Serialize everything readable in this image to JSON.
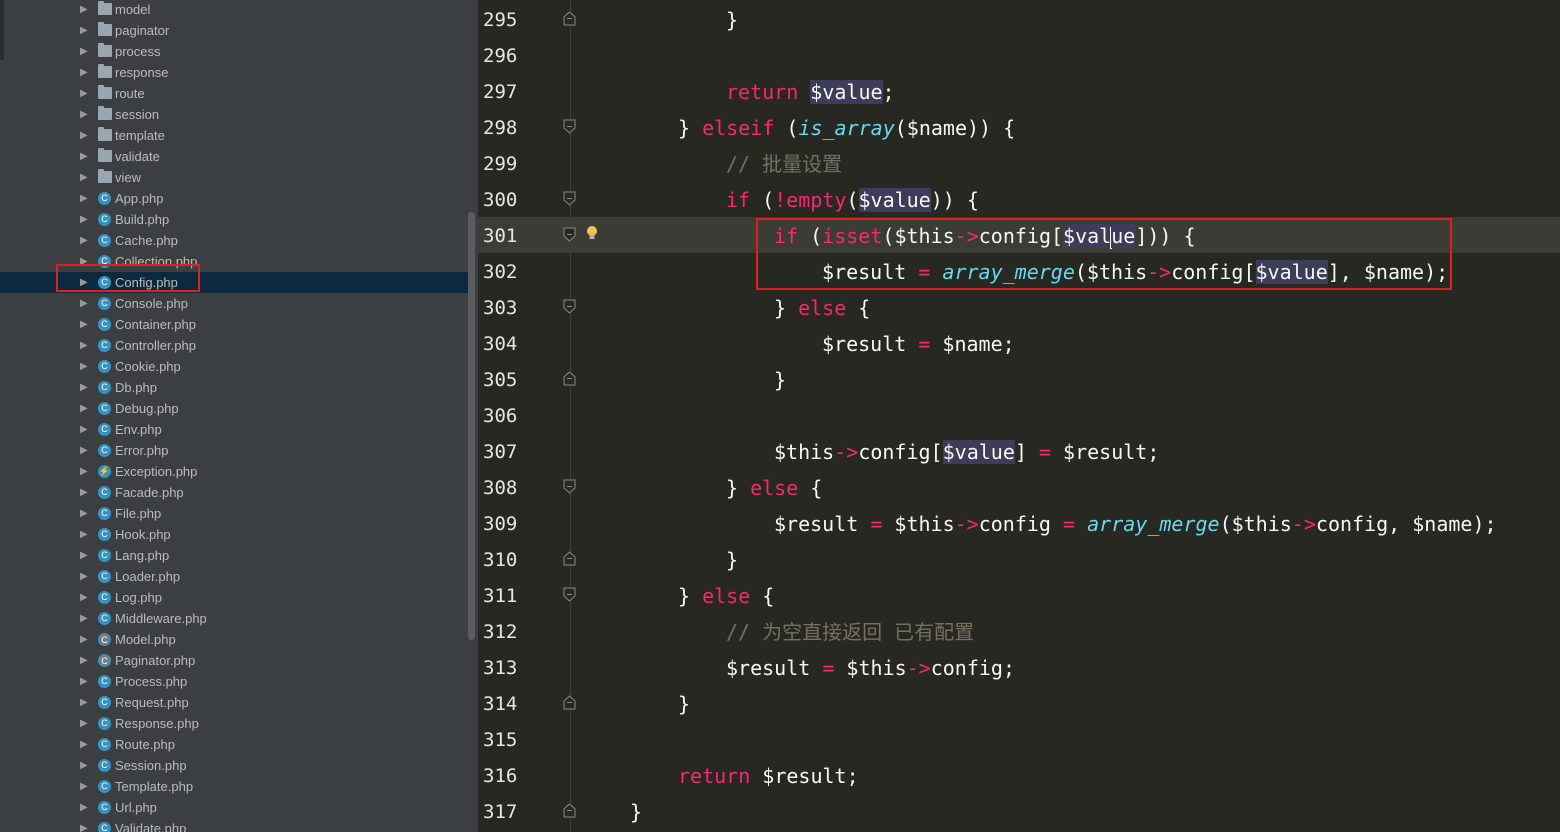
{
  "project_tree": {
    "items": [
      {
        "name": "model",
        "type": "folder"
      },
      {
        "name": "paginator",
        "type": "folder"
      },
      {
        "name": "process",
        "type": "folder"
      },
      {
        "name": "response",
        "type": "folder"
      },
      {
        "name": "route",
        "type": "folder"
      },
      {
        "name": "session",
        "type": "folder"
      },
      {
        "name": "template",
        "type": "folder"
      },
      {
        "name": "validate",
        "type": "folder"
      },
      {
        "name": "view",
        "type": "folder"
      },
      {
        "name": "App.php",
        "type": "class"
      },
      {
        "name": "Build.php",
        "type": "class"
      },
      {
        "name": "Cache.php",
        "type": "class"
      },
      {
        "name": "Collection.php",
        "type": "class"
      },
      {
        "name": "Config.php",
        "type": "class",
        "selected": true
      },
      {
        "name": "Console.php",
        "type": "class"
      },
      {
        "name": "Container.php",
        "type": "class"
      },
      {
        "name": "Controller.php",
        "type": "class"
      },
      {
        "name": "Cookie.php",
        "type": "class"
      },
      {
        "name": "Db.php",
        "type": "class"
      },
      {
        "name": "Debug.php",
        "type": "class"
      },
      {
        "name": "Env.php",
        "type": "class"
      },
      {
        "name": "Error.php",
        "type": "class"
      },
      {
        "name": "Exception.php",
        "type": "exception"
      },
      {
        "name": "Facade.php",
        "type": "class"
      },
      {
        "name": "File.php",
        "type": "class"
      },
      {
        "name": "Hook.php",
        "type": "class"
      },
      {
        "name": "Lang.php",
        "type": "class"
      },
      {
        "name": "Loader.php",
        "type": "class"
      },
      {
        "name": "Log.php",
        "type": "class"
      },
      {
        "name": "Middleware.php",
        "type": "class"
      },
      {
        "name": "Model.php",
        "type": "abstract"
      },
      {
        "name": "Paginator.php",
        "type": "abstract"
      },
      {
        "name": "Process.php",
        "type": "class"
      },
      {
        "name": "Request.php",
        "type": "class"
      },
      {
        "name": "Response.php",
        "type": "class"
      },
      {
        "name": "Route.php",
        "type": "class"
      },
      {
        "name": "Session.php",
        "type": "class"
      },
      {
        "name": "Template.php",
        "type": "class"
      },
      {
        "name": "Url.php",
        "type": "class"
      },
      {
        "name": "Validate.php",
        "type": "class"
      }
    ]
  },
  "editor": {
    "lines": [
      {
        "no": "295",
        "indent": 5,
        "fold": "end",
        "tokens": [
          [
            "",
            "}"
          ]
        ]
      },
      {
        "no": "296",
        "indent": 0,
        "fold": "",
        "tokens": []
      },
      {
        "no": "297",
        "indent": 5,
        "fold": "",
        "tokens": [
          [
            "kw",
            "return"
          ],
          [
            "",
            " "
          ],
          [
            "hl",
            "$value"
          ],
          [
            "",
            ";"
          ]
        ]
      },
      {
        "no": "298",
        "indent": 4,
        "fold": "mid",
        "tokens": [
          [
            "",
            "} "
          ],
          [
            "kw",
            "elseif"
          ],
          [
            "",
            " ("
          ],
          [
            "fn",
            "is_array"
          ],
          [
            "",
            "($name)) {"
          ]
        ]
      },
      {
        "no": "299",
        "indent": 5,
        "fold": "",
        "tokens": [
          [
            "cm",
            "// 批量设置"
          ]
        ]
      },
      {
        "no": "300",
        "indent": 5,
        "fold": "start",
        "tokens": [
          [
            "kw",
            "if"
          ],
          [
            "",
            " ("
          ],
          [
            "op",
            "!"
          ],
          [
            "kw",
            "empty"
          ],
          [
            "",
            "("
          ],
          [
            "hl",
            "$value"
          ],
          [
            "",
            ")) {"
          ]
        ]
      },
      {
        "no": "301",
        "indent": 6,
        "fold": "start",
        "caret": true,
        "bulb": true,
        "tokens": [
          [
            "kw",
            "if"
          ],
          [
            "",
            " ("
          ],
          [
            "kw",
            "isset"
          ],
          [
            "",
            "($this"
          ],
          [
            "op",
            "->"
          ],
          [
            "",
            "config["
          ],
          [
            "hl",
            "$val"
          ],
          [
            "cursor",
            ""
          ],
          [
            "hl",
            "ue"
          ],
          [
            "",
            "])) {"
          ]
        ]
      },
      {
        "no": "302",
        "indent": 7,
        "fold": "",
        "tokens": [
          [
            "",
            "$result "
          ],
          [
            "op",
            "="
          ],
          [
            "",
            " "
          ],
          [
            "fn",
            "array_merge"
          ],
          [
            "",
            "($this"
          ],
          [
            "op",
            "->"
          ],
          [
            "",
            "config["
          ],
          [
            "hl",
            "$value"
          ],
          [
            "",
            "], $name);"
          ]
        ]
      },
      {
        "no": "303",
        "indent": 6,
        "fold": "mid",
        "tokens": [
          [
            "",
            "} "
          ],
          [
            "kw",
            "else"
          ],
          [
            "",
            " {"
          ]
        ]
      },
      {
        "no": "304",
        "indent": 7,
        "fold": "",
        "tokens": [
          [
            "",
            "$result "
          ],
          [
            "op",
            "="
          ],
          [
            "",
            " $name;"
          ]
        ]
      },
      {
        "no": "305",
        "indent": 6,
        "fold": "end",
        "tokens": [
          [
            "",
            "}"
          ]
        ]
      },
      {
        "no": "306",
        "indent": 0,
        "fold": "",
        "tokens": []
      },
      {
        "no": "307",
        "indent": 6,
        "fold": "",
        "tokens": [
          [
            "",
            "$this"
          ],
          [
            "op",
            "->"
          ],
          [
            "",
            "config["
          ],
          [
            "hl",
            "$value"
          ],
          [
            "",
            "] "
          ],
          [
            "op",
            "="
          ],
          [
            "",
            " $result;"
          ]
        ]
      },
      {
        "no": "308",
        "indent": 5,
        "fold": "mid",
        "tokens": [
          [
            "",
            "} "
          ],
          [
            "kw",
            "else"
          ],
          [
            "",
            " {"
          ]
        ]
      },
      {
        "no": "309",
        "indent": 6,
        "fold": "",
        "tokens": [
          [
            "",
            "$result "
          ],
          [
            "op",
            "="
          ],
          [
            "",
            " $this"
          ],
          [
            "op",
            "->"
          ],
          [
            "",
            "config "
          ],
          [
            "op",
            "="
          ],
          [
            "",
            " "
          ],
          [
            "fn",
            "array_merge"
          ],
          [
            "",
            "($this"
          ],
          [
            "op",
            "->"
          ],
          [
            "",
            "config, $name);"
          ]
        ]
      },
      {
        "no": "310",
        "indent": 5,
        "fold": "end",
        "tokens": [
          [
            "",
            "}"
          ]
        ]
      },
      {
        "no": "311",
        "indent": 4,
        "fold": "mid",
        "tokens": [
          [
            "",
            "} "
          ],
          [
            "kw",
            "else"
          ],
          [
            "",
            " {"
          ]
        ]
      },
      {
        "no": "312",
        "indent": 5,
        "fold": "",
        "tokens": [
          [
            "cm",
            "// 为空直接返回 已有配置"
          ]
        ]
      },
      {
        "no": "313",
        "indent": 5,
        "fold": "",
        "tokens": [
          [
            "",
            "$result "
          ],
          [
            "op",
            "="
          ],
          [
            "",
            " $this"
          ],
          [
            "op",
            "->"
          ],
          [
            "",
            "config;"
          ]
        ]
      },
      {
        "no": "314",
        "indent": 4,
        "fold": "end",
        "tokens": [
          [
            "",
            "}"
          ]
        ]
      },
      {
        "no": "315",
        "indent": 0,
        "fold": "",
        "tokens": []
      },
      {
        "no": "316",
        "indent": 4,
        "fold": "",
        "tokens": [
          [
            "kw",
            "return"
          ],
          [
            "",
            " $result;"
          ]
        ]
      },
      {
        "no": "317",
        "indent": 3,
        "fold": "end",
        "tokens": [
          [
            "",
            "}"
          ]
        ]
      }
    ]
  },
  "colors": {
    "editor_bg": "#272822",
    "sidebar_bg": "#3c3f41",
    "keyword": "#f92672",
    "function": "#66d9ef",
    "comment": "#75715e",
    "annotation_box": "#e02020"
  }
}
